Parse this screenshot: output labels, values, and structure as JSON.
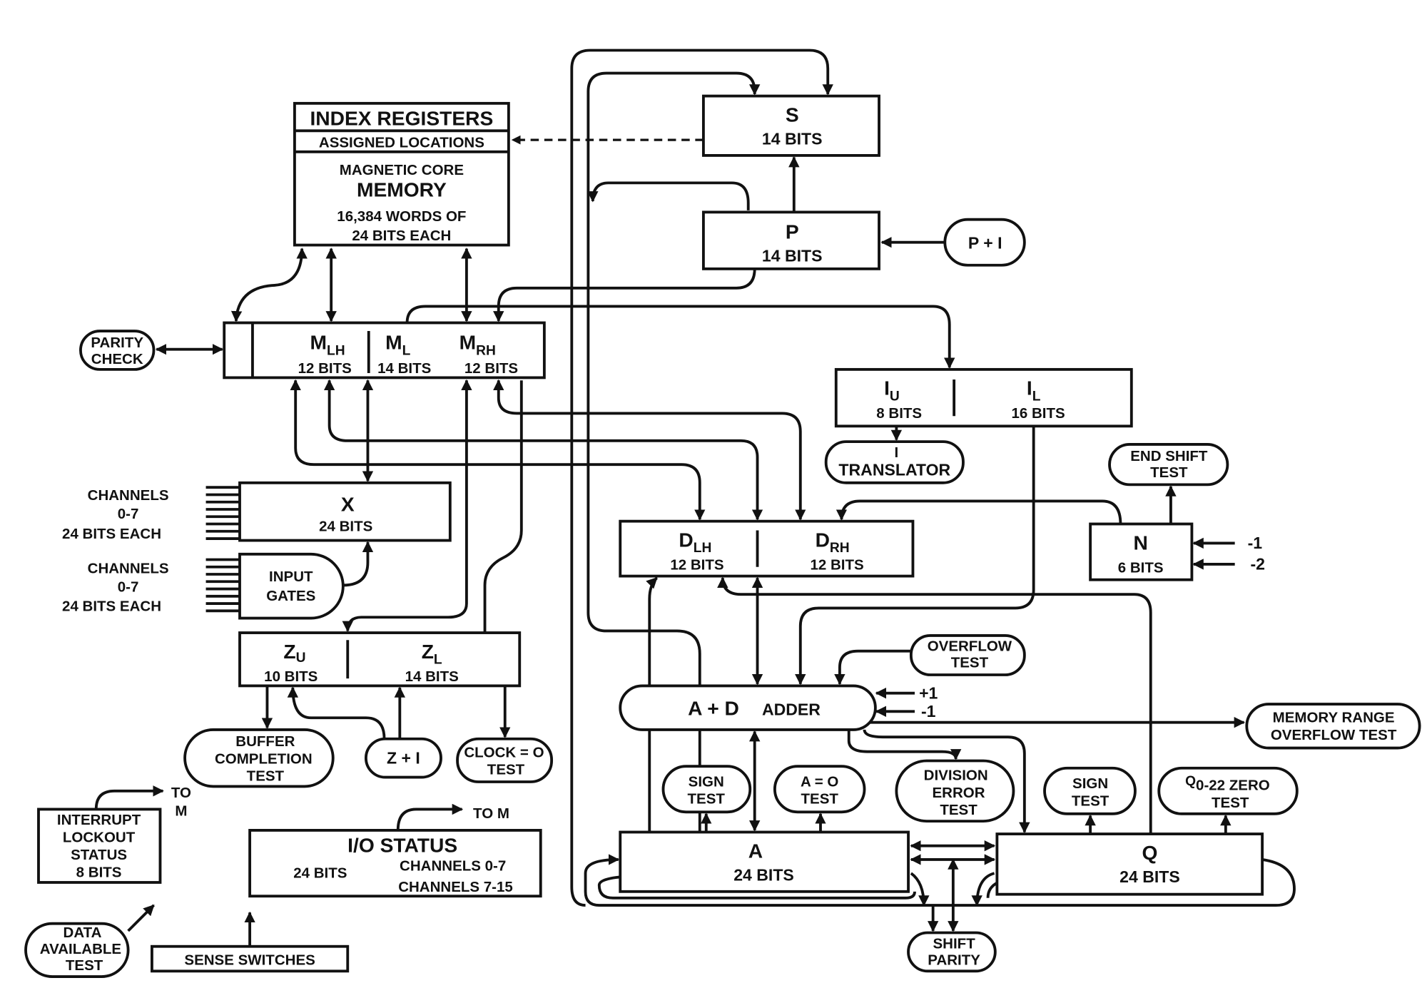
{
  "memory": {
    "index_registers": "INDEX REGISTERS",
    "assigned_locations": "ASSIGNED LOCATIONS",
    "line1": "MAGNETIC CORE",
    "line2": "MEMORY",
    "line3": "16,384 WORDS OF",
    "line4": "24 BITS EACH"
  },
  "s_reg": {
    "name": "S",
    "bits": "14 BITS"
  },
  "p_reg": {
    "name": "P",
    "bits": "14 BITS"
  },
  "p_plus_one": "P + I",
  "m_reg": {
    "lh": {
      "name": "M",
      "sub": "LH",
      "bits": "12 BITS"
    },
    "l": {
      "name": "M",
      "sub": "L",
      "bits": "14 BITS"
    },
    "rh": {
      "name": "M",
      "sub": "RH",
      "bits": "12 BITS"
    }
  },
  "parity_check": [
    "PARITY",
    "CHECK"
  ],
  "i_reg": {
    "u": {
      "name": "I",
      "sub": "U",
      "bits": "8 BITS"
    },
    "l": {
      "name": "I",
      "sub": "L",
      "bits": "16 BITS"
    }
  },
  "translator": [
    "I",
    "TRANSLATOR"
  ],
  "end_shift_test": [
    "END SHIFT",
    "TEST"
  ],
  "n_reg": {
    "name": "N",
    "bits": "6 BITS"
  },
  "n_inputs": [
    "-1",
    "-2"
  ],
  "x_reg": {
    "name": "X",
    "bits": "24 BITS"
  },
  "channels_out": [
    "CHANNELS",
    "0-7",
    "24 BITS EACH"
  ],
  "channels_in": [
    "CHANNELS",
    "0-7",
    "24 BITS EACH"
  ],
  "input_gates": [
    "INPUT",
    "GATES"
  ],
  "d_reg": {
    "lh": {
      "name": "D",
      "sub": "LH",
      "bits": "12 BITS"
    },
    "rh": {
      "name": "D",
      "sub": "RH",
      "bits": "12 BITS"
    }
  },
  "z_reg": {
    "u": {
      "name": "Z",
      "sub": "U",
      "bits": "10 BITS"
    },
    "l": {
      "name": "Z",
      "sub": "L",
      "bits": "14 BITS"
    }
  },
  "buffer_completion_test": [
    "BUFFER",
    "COMPLETION",
    "TEST"
  ],
  "z_plus_one": "Z + I",
  "clock_zero_test": [
    "CLOCK = O",
    "TEST"
  ],
  "overflow_test": [
    "OVERFLOW",
    "TEST"
  ],
  "adder": {
    "name": "A + D",
    "suffix": "ADDER"
  },
  "adder_inputs": [
    "+1",
    "-1"
  ],
  "memory_range_overflow_test": [
    "MEMORY RANGE",
    "OVERFLOW TEST"
  ],
  "a_sign_test": [
    "SIGN",
    "TEST"
  ],
  "a_zero_test": [
    "A = O",
    "TEST"
  ],
  "division_error_test": [
    "DIVISION",
    "ERROR",
    "TEST"
  ],
  "q_sign_test": [
    "SIGN",
    "TEST"
  ],
  "q_zero_test": {
    "name": "Q",
    "rest": "0-22 ZERO",
    "line2": "TEST"
  },
  "a_reg": {
    "name": "A",
    "bits": "24 BITS"
  },
  "q_reg": {
    "name": "Q",
    "bits": "24 BITS"
  },
  "shift_parity": [
    "SHIFT",
    "PARITY"
  ],
  "interrupt_lockout": [
    "INTERRUPT",
    "LOCKOUT",
    "STATUS",
    "8 BITS"
  ],
  "to_m_1": [
    "TO",
    "M"
  ],
  "io_status": {
    "title": "I/O STATUS",
    "bits": "24 BITS",
    "ch1": "CHANNELS 0-7",
    "ch2": "CHANNELS 7-15"
  },
  "to_m_2": "TO M",
  "data_available_test": [
    "DATA",
    "AVAILABLE",
    "TEST"
  ],
  "sense_switches": "SENSE SWITCHES"
}
